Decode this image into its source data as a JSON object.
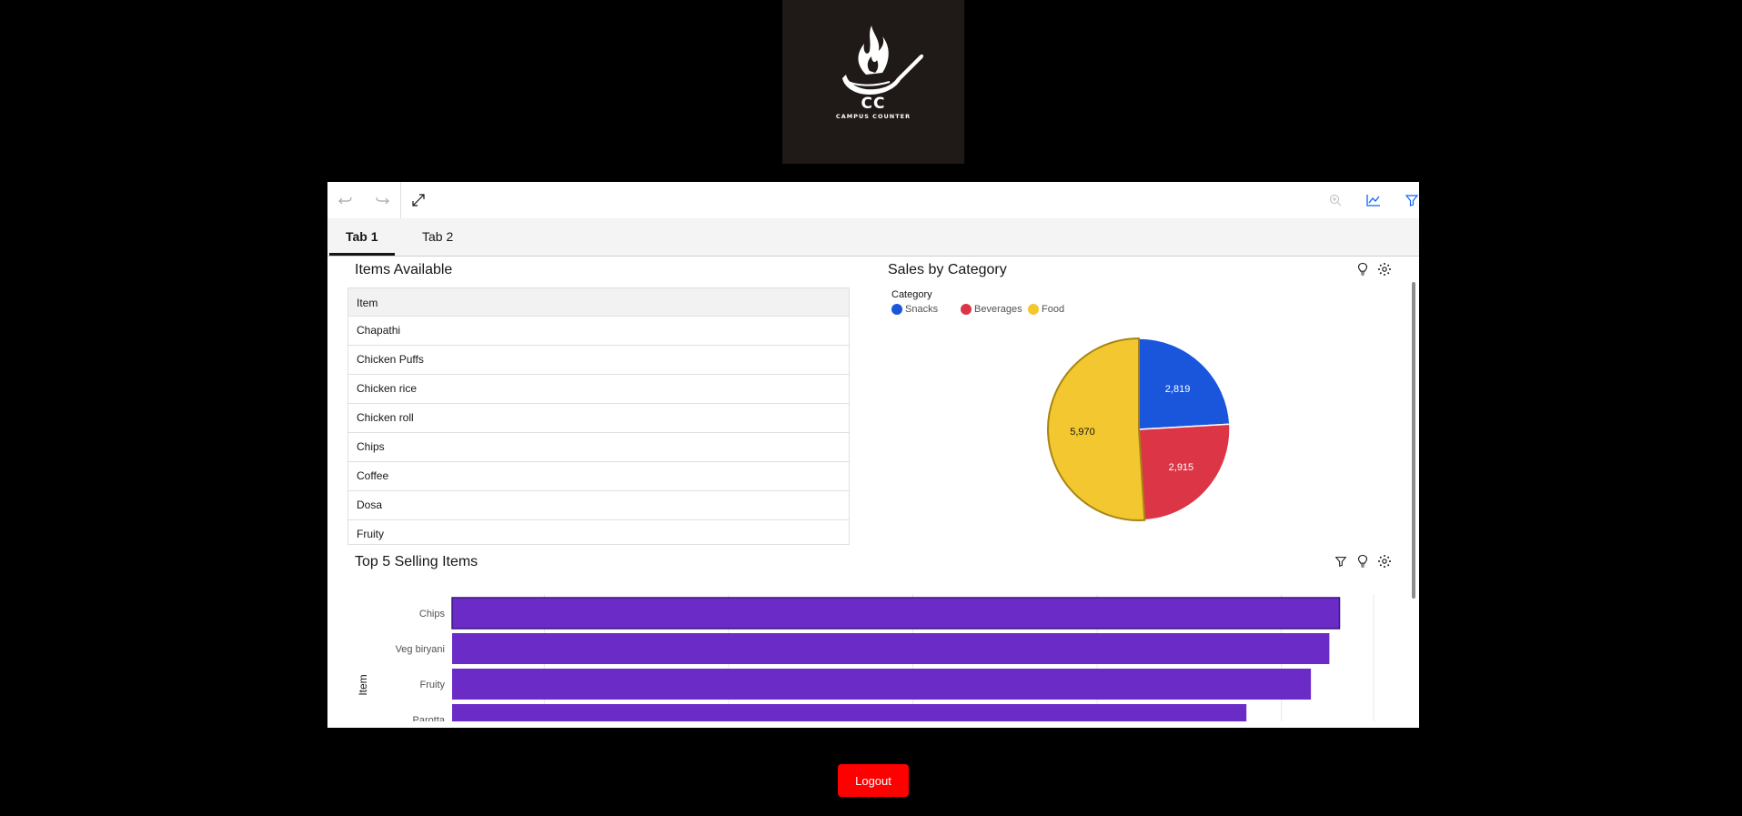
{
  "logo": {
    "initials": "CC",
    "name": "CAMPUS COUNTER"
  },
  "toolbar": {
    "undo_icon": "undo-icon",
    "redo_icon": "redo-icon",
    "fullscreen_icon": "expand-icon",
    "zoom_icon": "zoom-icon",
    "chart_icon": "line-chart-icon",
    "filter_icon": "filter-icon"
  },
  "tabs": [
    {
      "label": "Tab 1",
      "active": true
    },
    {
      "label": "Tab 2",
      "active": false
    }
  ],
  "items_widget": {
    "title": "Items Available",
    "column": "Item",
    "rows": [
      "Chapathi",
      "Chicken Puffs",
      "Chicken rice",
      "Chicken roll",
      "Chips",
      "Coffee",
      "Dosa",
      "Fruity"
    ]
  },
  "sales_widget": {
    "title": "Sales by Category",
    "legend_title": "Category"
  },
  "top5_widget": {
    "title": "Top 5 Selling Items",
    "yaxis_label": "Item"
  },
  "chart_data": [
    {
      "type": "pie",
      "title": "Sales by Category",
      "legend_title": "Category",
      "legend_position": "top-left",
      "slices": [
        {
          "name": "Snacks",
          "value": 2819,
          "label": "2,819",
          "color": "#1a56db"
        },
        {
          "name": "Beverages",
          "value": 2915,
          "label": "2,915",
          "color": "#dc3545"
        },
        {
          "name": "Food",
          "value": 5970,
          "label": "5,970",
          "color": "#f2c72f"
        }
      ]
    },
    {
      "type": "bar",
      "orientation": "horizontal",
      "title": "Top 5 Selling Items",
      "ylabel": "Item",
      "categories": [
        "Chips",
        "Veg biryani",
        "Fruity",
        "Parotta"
      ],
      "values": [
        963,
        952,
        932,
        862
      ],
      "xlim": [
        0,
        1000
      ],
      "color": "#6a2bc7"
    }
  ],
  "logout": {
    "label": "Logout"
  },
  "colors": {
    "accent": "#0f62fe",
    "bar": "#6a2bc7",
    "logout": "#ff0000"
  }
}
